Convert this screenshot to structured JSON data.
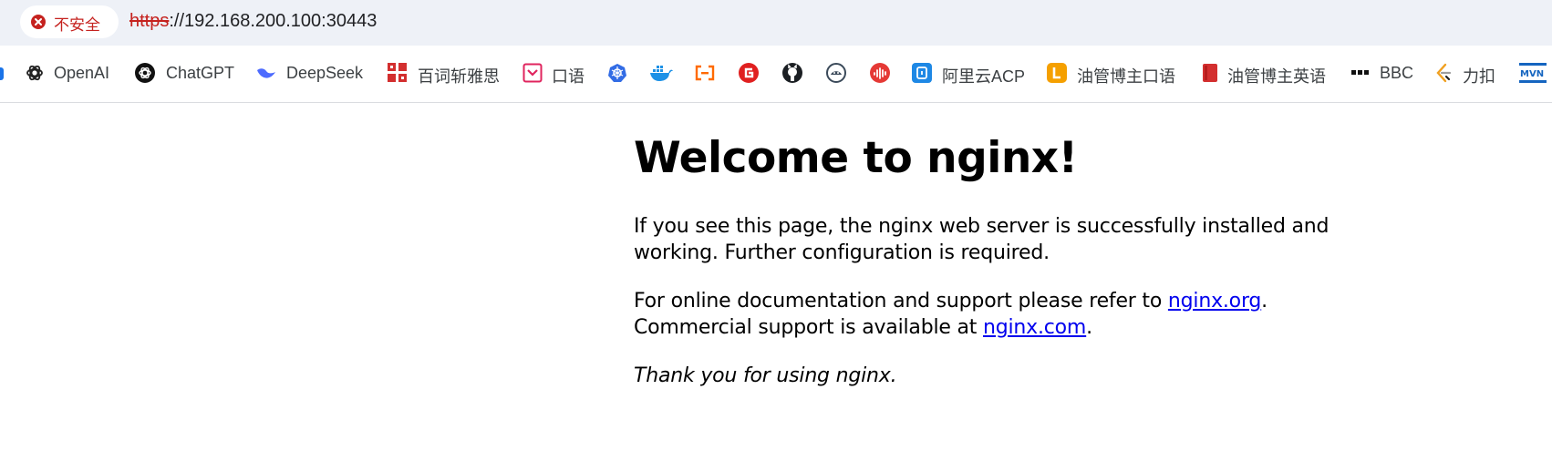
{
  "address_bar": {
    "security_label": "不安全",
    "url_scheme": "https",
    "url_rest": "://192.168.200.100:30443"
  },
  "bookmarks": [
    {
      "label": "OpenAI",
      "icon": "openai-icon"
    },
    {
      "label": "ChatGPT",
      "icon": "chatgpt-icon"
    },
    {
      "label": "DeepSeek",
      "icon": "deepseek-icon"
    },
    {
      "label": "百词斩雅思",
      "icon": "baicizhan-icon"
    },
    {
      "label": "口语",
      "icon": "pocket-icon"
    },
    {
      "label": "",
      "icon": "kubernetes-icon"
    },
    {
      "label": "",
      "icon": "docker-icon"
    },
    {
      "label": "",
      "icon": "aliyun-bracket-icon"
    },
    {
      "label": "",
      "icon": "g-logo-icon"
    },
    {
      "label": "",
      "icon": "github-icon"
    },
    {
      "label": "",
      "icon": "podman-icon"
    },
    {
      "label": "",
      "icon": "audio-wave-icon"
    },
    {
      "label": "阿里云ACP",
      "icon": "aliyun-acp-icon"
    },
    {
      "label": "油管博主口语",
      "icon": "letter-l-icon"
    },
    {
      "label": "油管博主英语",
      "icon": "red-book-icon"
    },
    {
      "label": "BBC",
      "icon": "bbc-icon"
    },
    {
      "label": "力扣",
      "icon": "leetcode-icon"
    },
    {
      "label": "",
      "icon": "mvn-icon"
    }
  ],
  "page": {
    "heading": "Welcome to nginx!",
    "para1": "If you see this page, the nginx web server is successfully installed and working. Further configuration is required.",
    "para2_text1": "For online documentation and support please refer to ",
    "para2_link1": "nginx.org",
    "para2_text2": ".",
    "para2_text3": "Commercial support is available at ",
    "para2_link2": "nginx.com",
    "para2_text4": ".",
    "para3": "Thank you for using nginx."
  },
  "colors": {
    "insecure_red": "#c5221f",
    "link_blue": "#0000ee",
    "addressbar_bg": "#eef1f7"
  }
}
